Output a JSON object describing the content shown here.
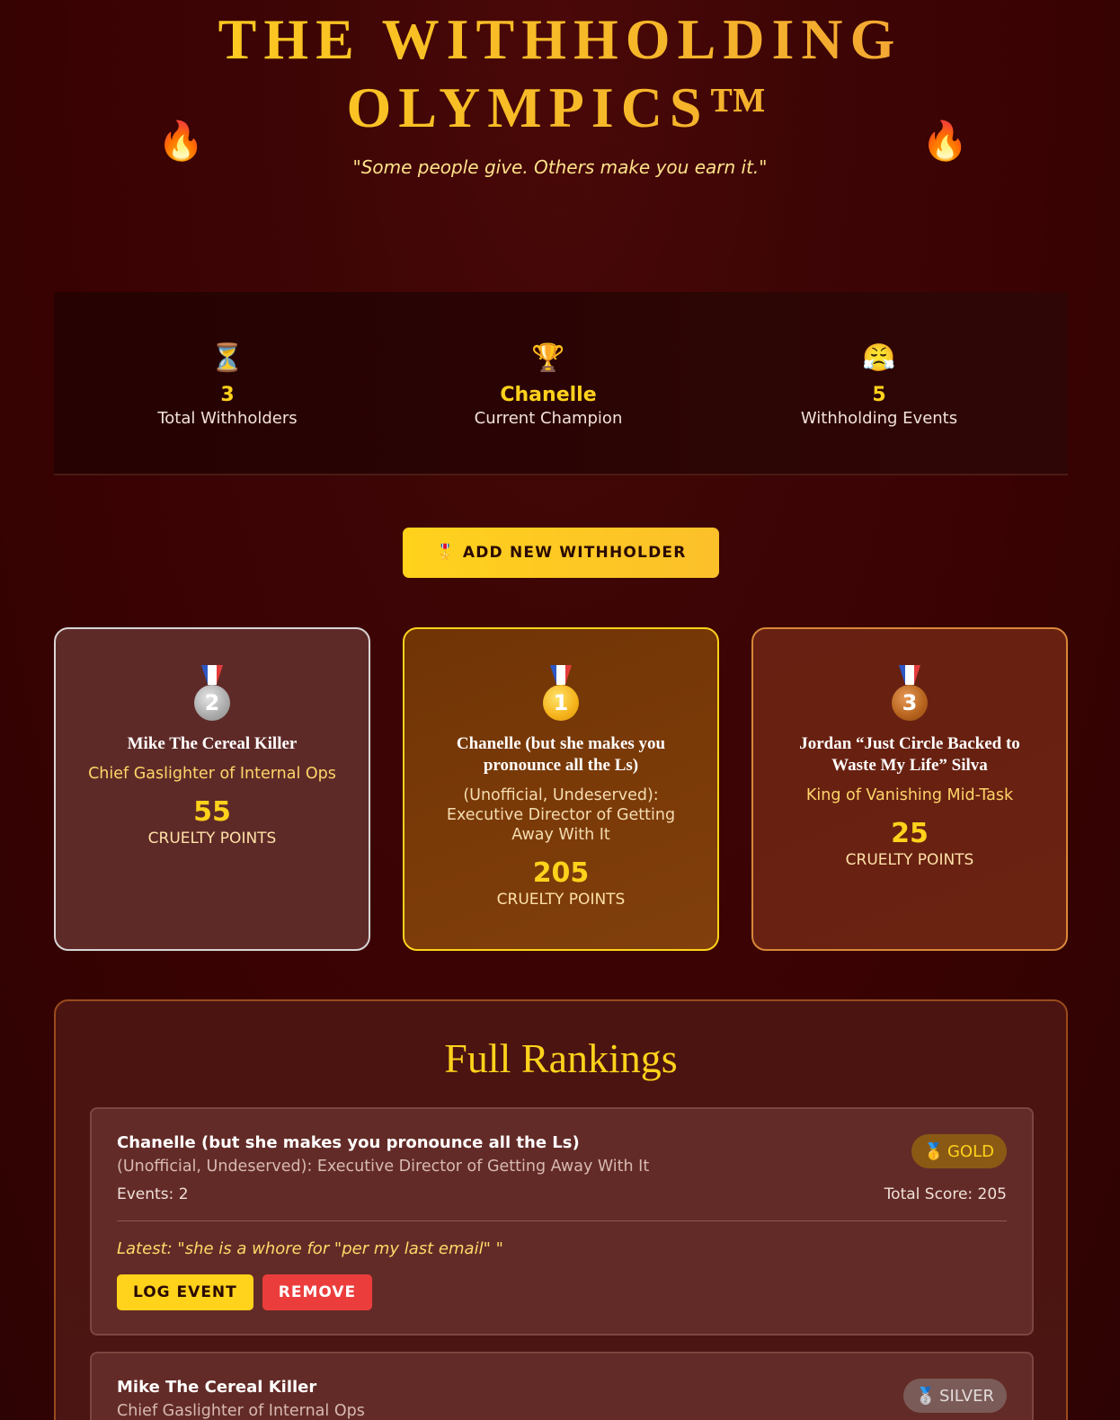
{
  "header": {
    "title_line1": "THE WITHHOLDING",
    "title_line2": "OLYMPICS™",
    "fire_glyph": "🔥",
    "tagline": "\"Some people give. Others make you earn it.\""
  },
  "stats": [
    {
      "icon": "⏳",
      "value": "3",
      "label": "Total Withholders"
    },
    {
      "icon": "🏆",
      "value": "Chanelle",
      "label": "Current Champion"
    },
    {
      "icon": "😤",
      "value": "5",
      "label": "Withholding Events"
    }
  ],
  "add_button": {
    "icon": "🎖️",
    "label": "ADD NEW WITHHOLDER"
  },
  "podium": [
    {
      "rank": "2",
      "name": "Mike The Cereal Killer",
      "title": "Chief Gaslighter of Internal Ops",
      "score": "55",
      "unit": "CRUELTY POINTS"
    },
    {
      "rank": "1",
      "name": "Chanelle (but she makes you pronounce all the Ls)",
      "title": "(Unofficial, Undeserved): Executive Director of Getting Away With It",
      "score": "205",
      "unit": "CRUELTY POINTS"
    },
    {
      "rank": "3",
      "name": "Jordan “Just Circle Backed to Waste My Life” Silva",
      "title": "King of Vanishing Mid-Task",
      "score": "25",
      "unit": "CRUELTY POINTS"
    }
  ],
  "rankings": {
    "heading": "Full Rankings",
    "entries": [
      {
        "name": "Chanelle (but she makes you pronounce all the Ls)",
        "title": "(Unofficial, Undeserved): Executive Director of Getting Away With It",
        "events": "Events: 2",
        "total": "Total Score: 205",
        "badge_icon": "🥇",
        "badge_label": "GOLD",
        "latest": "Latest: \"she is a whore for \"per my last email\" \"",
        "log_label": "LOG EVENT",
        "remove_label": "REMOVE"
      },
      {
        "name": "Mike The Cereal Killer",
        "title": "Chief Gaslighter of Internal Ops",
        "badge_icon": "🥈",
        "badge_label": "SILVER"
      }
    ]
  },
  "colors": {
    "accent_gold": "#ffd21c",
    "background": "#3d0505",
    "remove_red": "#ec3d3d"
  }
}
